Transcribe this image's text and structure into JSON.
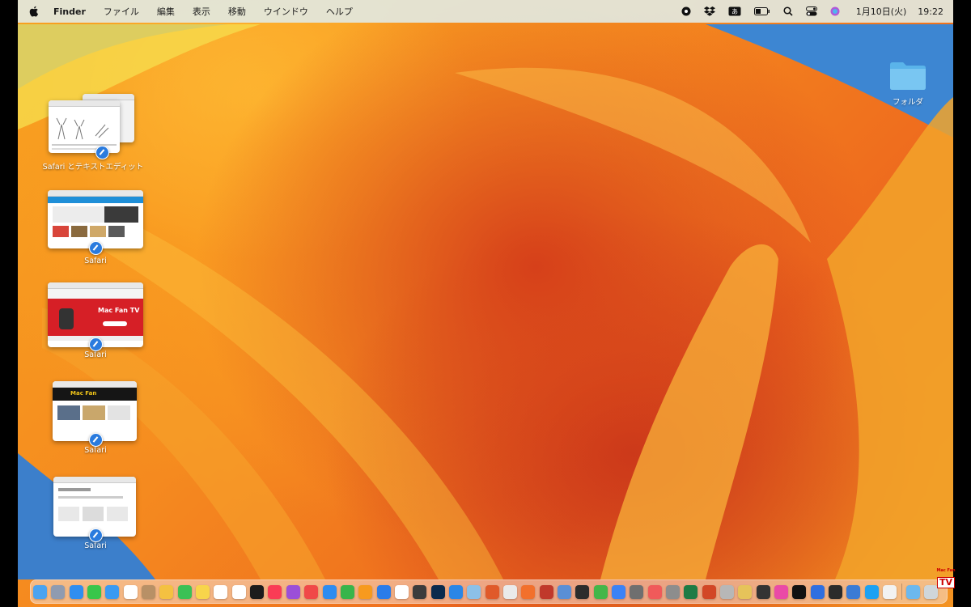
{
  "menubar": {
    "app_name": "Finder",
    "menus": [
      "ファイル",
      "編集",
      "表示",
      "移動",
      "ウインドウ",
      "ヘルプ"
    ],
    "date": "1月10日(火)",
    "time": "19:22"
  },
  "stacks": [
    {
      "label": "Safari とテキストエディット"
    },
    {
      "label": "Safari"
    },
    {
      "label": "Safari"
    },
    {
      "label": "Safari"
    },
    {
      "label": "Safari"
    }
  ],
  "thumbnails": {
    "mac_fan_tv": "Mac Fan TV",
    "mac_fan": "Mac Fan"
  },
  "desktop_folder": {
    "label": "フォルダ"
  },
  "watermark": {
    "brand": "Mac Fan",
    "tv": "TV"
  },
  "dock_apps": [
    {
      "name": "finder-icon",
      "color": "#4aa3f0"
    },
    {
      "name": "launchpad-icon",
      "color": "#8f9bb0"
    },
    {
      "name": "safari-icon",
      "color": "#2f8ef0"
    },
    {
      "name": "messages-icon",
      "color": "#39c64a"
    },
    {
      "name": "mail-icon",
      "color": "#3a9af2"
    },
    {
      "name": "calendar-icon",
      "color": "#ffffff"
    },
    {
      "name": "contacts-icon",
      "color": "#b89066"
    },
    {
      "name": "photos-icon",
      "color": "#f4c141"
    },
    {
      "name": "facetime-icon",
      "color": "#3ac155"
    },
    {
      "name": "notes-icon",
      "color": "#f8d54b"
    },
    {
      "name": "reminders-icon",
      "color": "#ffffff"
    },
    {
      "name": "freeform-icon",
      "color": "#ffffff"
    },
    {
      "name": "tv-icon",
      "color": "#1c1c1c"
    },
    {
      "name": "music-icon",
      "color": "#fa3c55"
    },
    {
      "name": "podcasts-icon",
      "color": "#9b4fd8"
    },
    {
      "name": "news-icon",
      "color": "#f04848"
    },
    {
      "name": "app-store-icon",
      "color": "#2d8cf0"
    },
    {
      "name": "numbers-icon",
      "color": "#38b54a"
    },
    {
      "name": "pages-icon",
      "color": "#f79a1e"
    },
    {
      "name": "keynote-icon",
      "color": "#2b7ce9"
    },
    {
      "name": "clock-icon",
      "color": "#ffffff"
    },
    {
      "name": "final-cut-icon",
      "color": "#3c3c3c"
    },
    {
      "name": "photoshop-icon",
      "color": "#0a2a4d"
    },
    {
      "name": "xcode-icon",
      "color": "#2a86e6"
    },
    {
      "name": "preview-icon",
      "color": "#8cc0e8"
    },
    {
      "name": "pixelmator-icon",
      "color": "#e05a2a"
    },
    {
      "name": "chrome-icon",
      "color": "#eaeaea"
    },
    {
      "name": "firefox-icon",
      "color": "#f2702c"
    },
    {
      "name": "davinci-icon",
      "color": "#c0392b"
    },
    {
      "name": "transmit-icon",
      "color": "#5a8fd6"
    },
    {
      "name": "terminal-icon",
      "color": "#2c2c2c"
    },
    {
      "name": "evernote-icon",
      "color": "#44b649"
    },
    {
      "name": "messenger-icon",
      "color": "#3b82f6"
    },
    {
      "name": "pencil-icon",
      "color": "#6f6f6f"
    },
    {
      "name": "screenflow-icon",
      "color": "#f05a5a"
    },
    {
      "name": "mirror-icon",
      "color": "#8d8d8d"
    },
    {
      "name": "excel-icon",
      "color": "#1e7b45"
    },
    {
      "name": "powerpoint-icon",
      "color": "#d24726"
    },
    {
      "name": "script-icon",
      "color": "#b7b7b7"
    },
    {
      "name": "automator-icon",
      "color": "#e6c35a"
    },
    {
      "name": "obs-icon",
      "color": "#333333"
    },
    {
      "name": "shortcuts-icon",
      "color": "#ea4aa6"
    },
    {
      "name": "xit-icon",
      "color": "#111111"
    },
    {
      "name": "camo-icon",
      "color": "#2f6fe0"
    },
    {
      "name": "audio-icon",
      "color": "#2b2b2b"
    },
    {
      "name": "screensharing-icon",
      "color": "#3a7bd5"
    },
    {
      "name": "twitter-icon",
      "color": "#1da1f2"
    },
    {
      "name": "textedit-icon",
      "color": "#f2f2f2"
    },
    {
      "name": "downloads-folder-icon",
      "color": "#6bb8ee"
    },
    {
      "name": "trash-icon",
      "color": "#cfd6da"
    }
  ]
}
